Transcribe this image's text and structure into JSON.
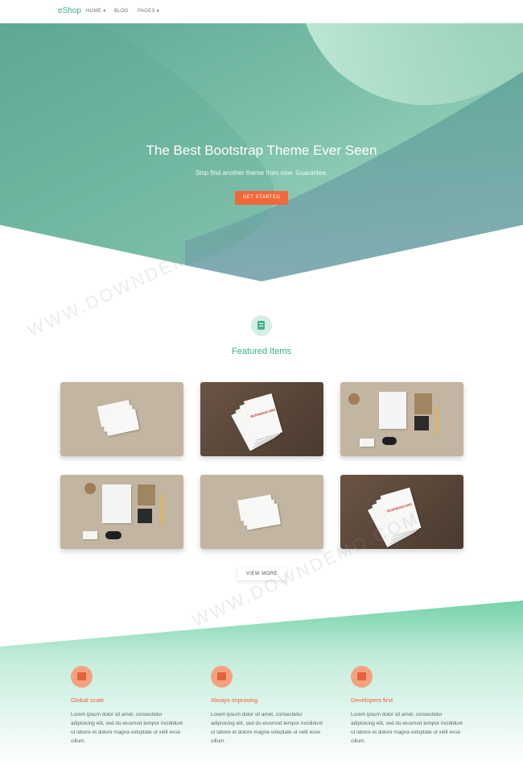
{
  "navbar": {
    "brand": "eShop",
    "items": [
      {
        "label": "HOME",
        "has_caret": true
      },
      {
        "label": "BLOG",
        "has_caret": false
      },
      {
        "label": "PAGES",
        "has_caret": true
      }
    ]
  },
  "hero": {
    "title": "The Best Bootstrap Theme Ever Seen",
    "subtitle": "Stop find another theme from now. Guarantee.",
    "cta_label": "GET STARTED",
    "colors": {
      "accent": "#f2673a",
      "bg_start": "#63aa98",
      "bg_end": "#bde8d6"
    }
  },
  "featured": {
    "icon": "document-icon",
    "title": "Featured Items",
    "items": [
      {
        "type": "business-cards-stack-on-tan"
      },
      {
        "type": "business-cards-fanned-on-dark"
      },
      {
        "type": "stationery-set-on-tan"
      },
      {
        "type": "stationery-set-on-tan"
      },
      {
        "type": "business-cards-stack-on-tan"
      },
      {
        "type": "business-cards-fanned-on-dark"
      }
    ],
    "card_print": "BUSINESSCARD",
    "view_more_label": "VIEW MORE"
  },
  "features": [
    {
      "icon": "briefcase-icon",
      "title": "Global scale",
      "text": "Lorem ipsum dolor sit amet, consectetur adipisicing elit, sed do eiusmod tempor incididunt ut labore et dolore magna voluptate ut velit esse cillum."
    },
    {
      "icon": "bag-icon",
      "title": "Always improving",
      "text": "Lorem ipsum dolor sit amet, consectetur adipisicing elit, sed do eiusmod tempor incididunt ut labore et dolore magna voluptate ut velit esse cillum."
    },
    {
      "icon": "file-icon",
      "title": "Developers first",
      "text": "Lorem ipsum dolor sit amet, consectetur adipisicing elit, sed do eiusmod tempor incididunt ut labore et dolore magna voluptate ut velit esse cillum."
    }
  ],
  "watermark": "WWW.DOWNDEMO.COM"
}
